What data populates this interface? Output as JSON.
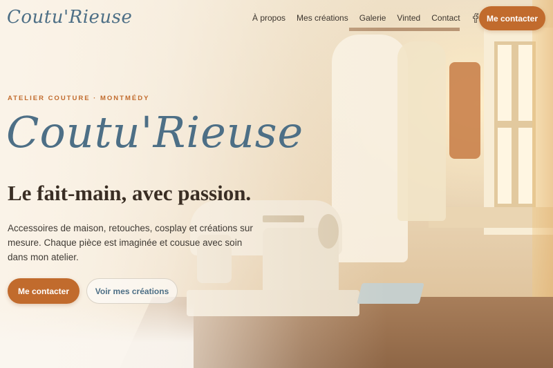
{
  "colors": {
    "accent": "#c16b2d",
    "brand_blue": "#4d6f86",
    "text_dark": "#3a2e24"
  },
  "nav": {
    "logo": "Coutu'Rieuse",
    "links": [
      "À propos",
      "Mes créations",
      "Galerie",
      "Vinted",
      "Contact"
    ],
    "social_icon": "facebook-icon",
    "cta_label": "Me contacter"
  },
  "hero": {
    "eyebrow": "ATELIER COUTURE · MONTMÉDY",
    "title": "Coutu'Rieuse",
    "subtitle": "Le fait-main, avec passion.",
    "description": "Accessoires de maison, retouches, cosplay et créations sur mesure. Chaque pièce est imaginée et cousue avec soin dans mon atelier.",
    "primary_button": "Me contacter",
    "secondary_button": "Voir mes créations"
  }
}
